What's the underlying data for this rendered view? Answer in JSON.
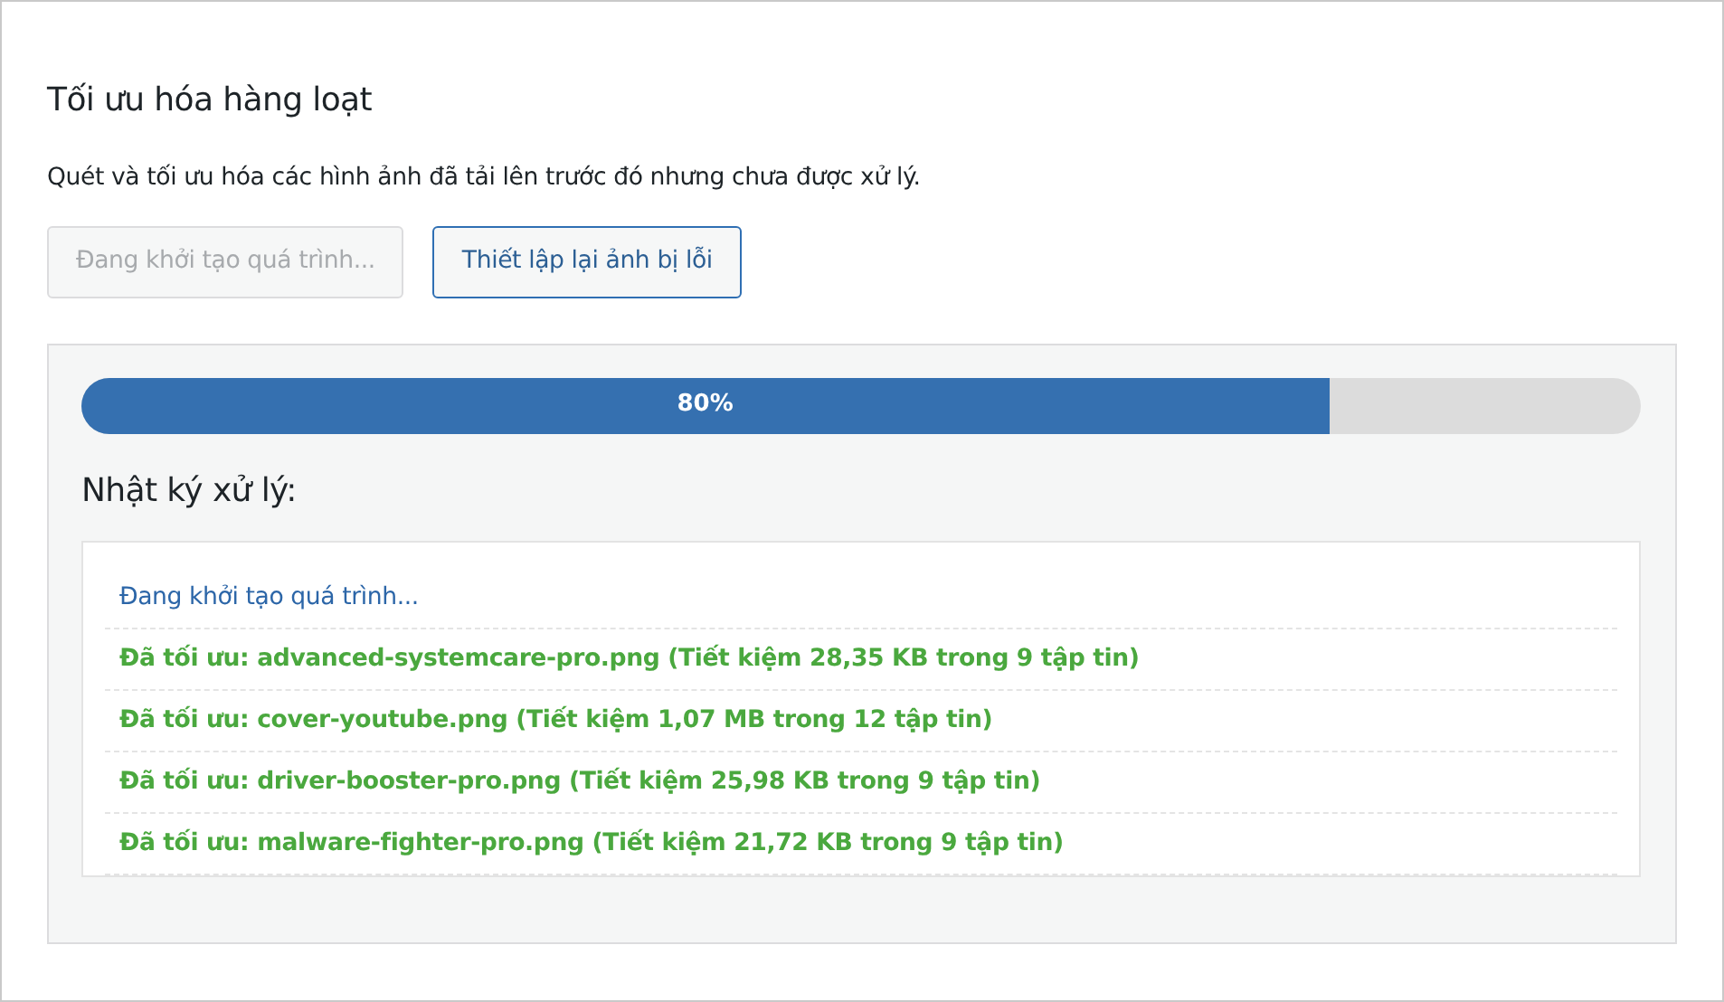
{
  "title": "Tối ưu hóa hàng loạt",
  "description": "Quét và tối ưu hóa các hình ảnh đã tải lên trước đó nhưng chưa được xử lý.",
  "buttons": [
    {
      "label": "Đang khởi tạo quá trình...",
      "disabled": true
    },
    {
      "label": "Thiết lập lại ảnh bị lỗi",
      "disabled": false
    }
  ],
  "progress": {
    "level": 0.8,
    "reading": "80%"
  },
  "log": {
    "heading": "Nhật ký xử lý:",
    "entries": [
      {
        "kind": "info",
        "text": "Đang khởi tạo quá trình..."
      },
      {
        "kind": "success",
        "text": "Đã tối ưu: advanced-systemcare-pro.png (Tiết kiệm 28,35 KB trong 9 tập tin)"
      },
      {
        "kind": "success",
        "text": "Đã tối ưu: cover-youtube.png (Tiết kiệm 1,07 MB trong 12 tập tin)"
      },
      {
        "kind": "success",
        "text": "Đã tối ưu: driver-booster-pro.png (Tiết kiệm 25,98 KB trong 9 tập tin)"
      },
      {
        "kind": "success",
        "text": "Đã tối ưu: malware-fighter-pro.png (Tiết kiệm 21,72 KB trong 9 tập tin)"
      }
    ]
  }
}
